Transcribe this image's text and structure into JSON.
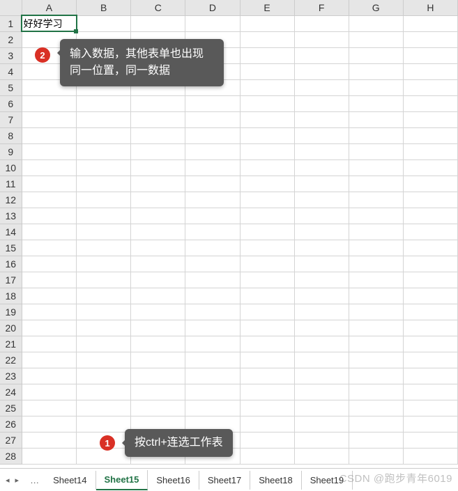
{
  "columns": [
    "A",
    "B",
    "C",
    "D",
    "E",
    "F",
    "G",
    "H"
  ],
  "row_count": 28,
  "active_cell": {
    "row": 1,
    "col": "A",
    "value": "好好学习"
  },
  "callouts": {
    "c1": {
      "badge": "1",
      "text": "按ctrl+连选工作表"
    },
    "c2": {
      "badge": "2",
      "text_line1": "输入数据，其他表单也出现",
      "text_line2": "同一位置，同一数据"
    }
  },
  "tabs": {
    "nav_prev": "◂",
    "nav_next": "▸",
    "ellipsis": "…",
    "items": [
      "Sheet14",
      "Sheet15",
      "Sheet16",
      "Sheet17",
      "Sheet18",
      "Sheet19"
    ],
    "active": "Sheet15"
  },
  "watermark": "CSDN @跑步青年6019"
}
